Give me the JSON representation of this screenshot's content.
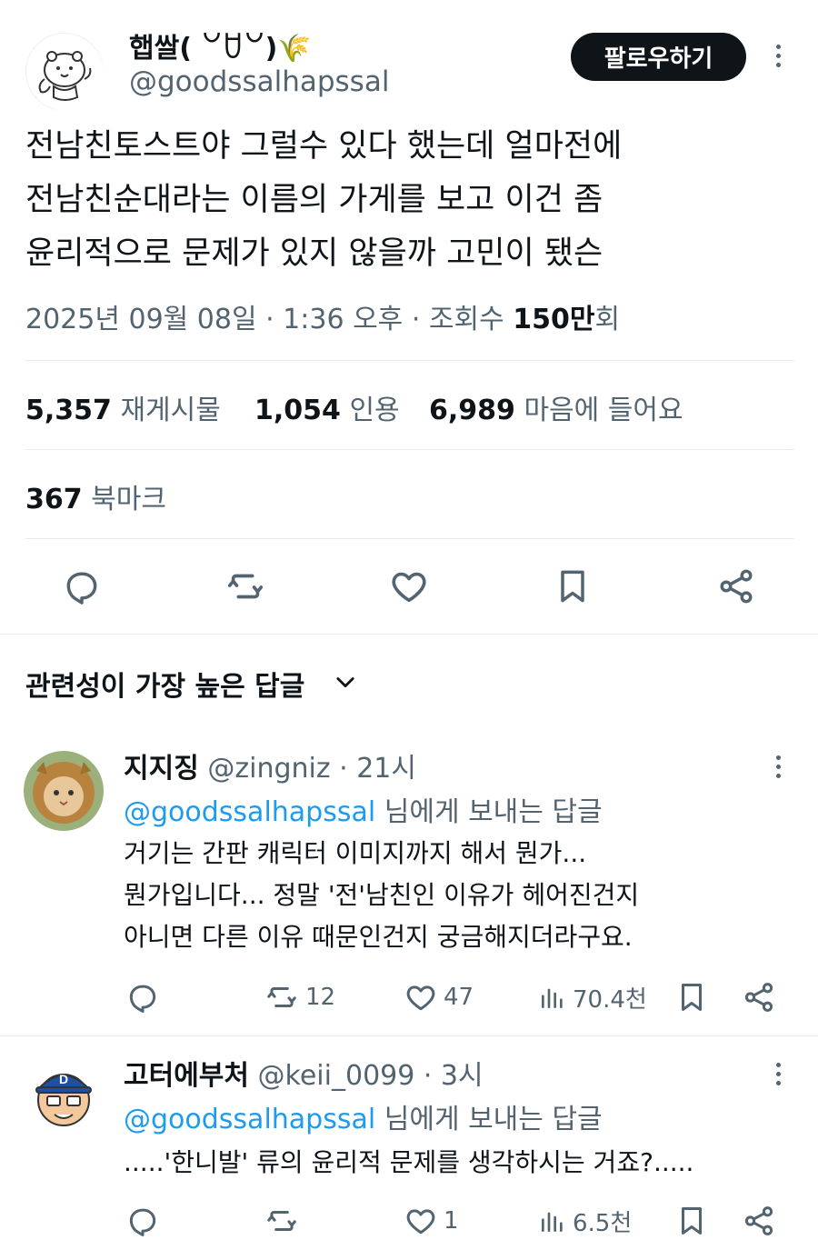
{
  "author": {
    "display_name": "햅쌀( ꒡ꇴ꒡)🌾",
    "handle": "@goodssalhapssal",
    "follow_label": "팔로우하기"
  },
  "tweet": {
    "lines": [
      "전남친토스트야 그럴수 있다 했는데 얼마전에",
      "전남친순대라는 이름의 가게를 보고 이건 좀",
      "윤리적으로 문제가 있지 않을까 고민이 됐슨"
    ],
    "datetime": "2025년 09월 08일 · 1:36 오후 · 조회수 ",
    "views_count": "150만",
    "views_suffix": "회"
  },
  "stats": {
    "reposts_count": "5,357",
    "reposts_label": "재게시물",
    "quotes_count": "1,054",
    "quotes_label": "인용",
    "likes_count": "6,989",
    "likes_label": "마음에 들어요",
    "bookmarks_count": "367",
    "bookmarks_label": "북마크"
  },
  "replies_section": {
    "sort_label": "관련성이 가장 높은 답글"
  },
  "replies": [
    {
      "name": "지지징",
      "handle": "@zingniz",
      "time": " · 21시",
      "reply_to_handle": "@goodssalhapssal",
      "reply_to_suffix": " 님에게 보내는 답글",
      "lines": [
        "거기는 간판 캐릭터 이미지까지 해서 뭔가...",
        "뭔가입니다... 정말 '전'남친인 이유가 헤어진건지",
        "아니면 다른 이유 때문인건지 궁금해지더라구요."
      ],
      "reposts": "12",
      "likes": "47",
      "views": "70.4천"
    },
    {
      "name": "고터에부처",
      "handle": "@keii_0099",
      "time": " · 3시",
      "reply_to_handle": "@goodssalhapssal",
      "reply_to_suffix": " 님에게 보내는 답글",
      "lines": [
        ".....'한니발' 류의 윤리적 문제를 생각하시는 거죠?....."
      ],
      "reposts": "",
      "likes": "1",
      "views": "6.5천"
    }
  ],
  "colors": {
    "text": "#0f1419",
    "muted": "#536471",
    "link": "#1d9bf0",
    "divider": "#e6ebee"
  }
}
